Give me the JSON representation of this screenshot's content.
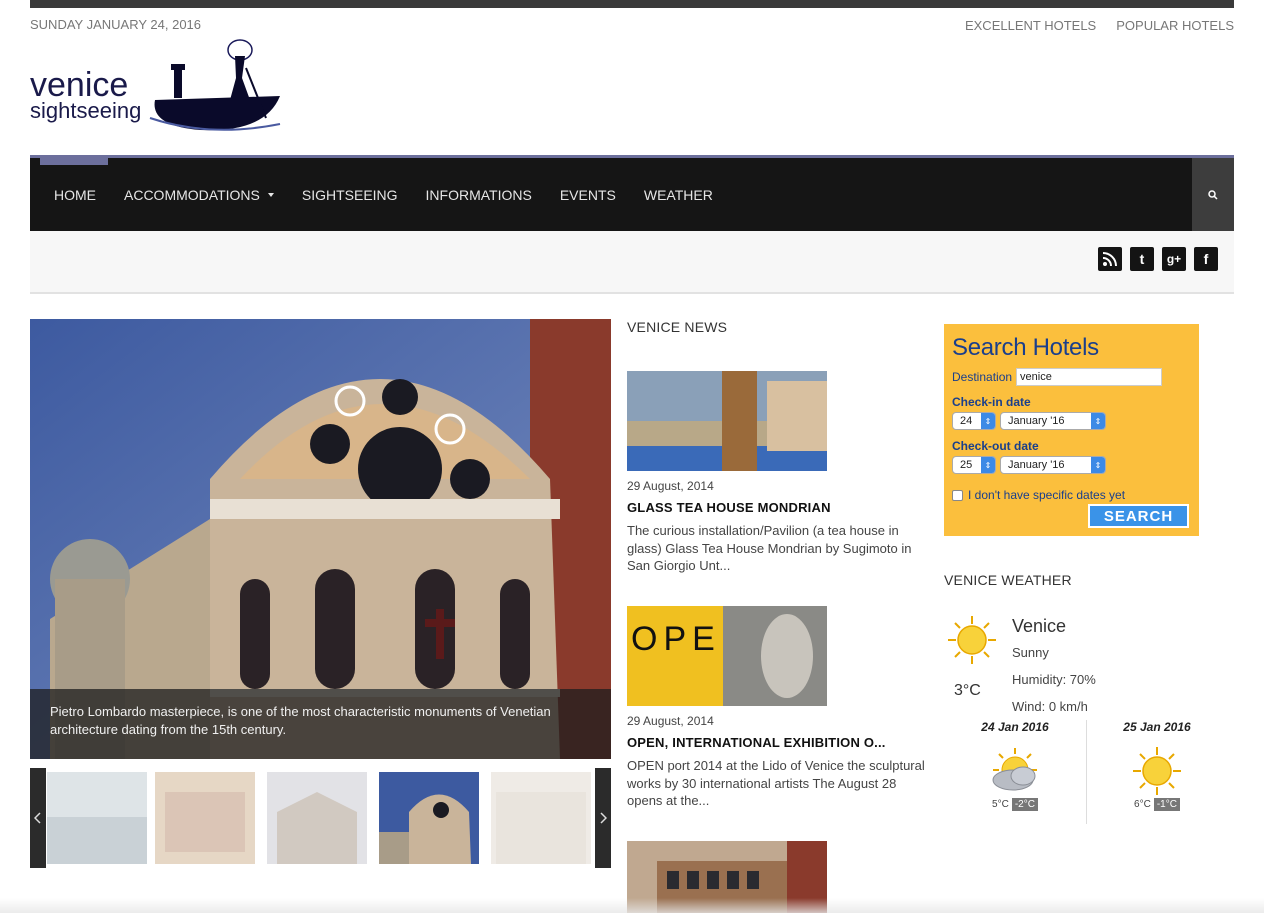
{
  "header": {
    "date": "SUNDAY JANUARY 24, 2016",
    "links": [
      "EXCELLENT HOTELS",
      "POPULAR HOTELS"
    ],
    "logo": {
      "line1": "venice",
      "line2": "sightseeing"
    }
  },
  "nav": {
    "items": [
      {
        "label": "HOME"
      },
      {
        "label": "ACCOMMODATIONS"
      },
      {
        "label": "SIGHTSEEING"
      },
      {
        "label": "INFORMATIONS"
      },
      {
        "label": "EVENTS"
      },
      {
        "label": "WEATHER"
      }
    ],
    "accent": "#6c6f9c"
  },
  "social": [
    "rss-icon",
    "twitter-icon",
    "google-plus-icon",
    "facebook-icon"
  ],
  "slider": {
    "caption": "Pietro Lombardo masterpiece, is one of the most characteristic monuments of Venetian architecture dating from the 15th century.",
    "active_thumb": 4
  },
  "news": {
    "title": "VENICE NEWS",
    "items": [
      {
        "date": "29 August, 2014",
        "title": "GLASS TEA HOUSE MONDRIAN",
        "excerpt": "The curious installation/Pavilion (a tea house in glass) Glass Tea House Mondrian by Sugimoto in San Giorgio Unt..."
      },
      {
        "date": "29 August, 2014",
        "title": "OPEN, INTERNATIONAL EXHIBITION O...",
        "excerpt": "OPEN port 2014 at the Lido of Venice the sculptural works by 30 international artists The August 28 opens at the...",
        "image_text": "OPEN"
      }
    ]
  },
  "hotels": {
    "title": "Search Hotels",
    "destination_label": "Destination",
    "destination_value": "venice",
    "checkin_label": "Check-in date",
    "checkin_day": "24",
    "checkin_month": "January '16",
    "checkout_label": "Check-out date",
    "checkout_day": "25",
    "checkout_month": "January '16",
    "no_dates_label": "I don't have specific dates yet",
    "search_label": "SEARCH",
    "colors": {
      "bg": "#fbbf3d",
      "text": "#1a3f8c",
      "button": "#3a93e8"
    }
  },
  "weather": {
    "title": "VENICE WEATHER",
    "city": "Venice",
    "condition": "Sunny",
    "humidity": "Humidity: 70%",
    "wind": "Wind: 0 km/h",
    "temp": "3°C",
    "forecast": [
      {
        "day": "24 Jan 2016",
        "high": "5°C",
        "low": "-2°C",
        "icon": "cloudy-sun-icon"
      },
      {
        "day": "25 Jan 2016",
        "high": "6°C",
        "low": "-1°C",
        "icon": "sun-icon"
      }
    ]
  }
}
